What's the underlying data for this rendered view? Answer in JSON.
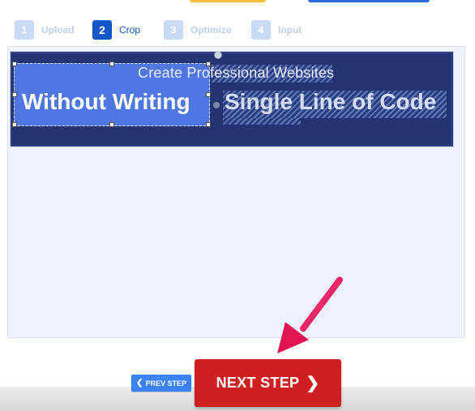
{
  "steps": [
    {
      "num": "1",
      "label": "Upload",
      "active": false
    },
    {
      "num": "2",
      "label": "Crop",
      "active": true
    },
    {
      "num": "3",
      "label": "Optimize",
      "active": false
    },
    {
      "num": "4",
      "label": "Input",
      "active": false
    }
  ],
  "banner": {
    "top_line": "Create Professional Websites",
    "main_left": "Without Writing",
    "main_right": "Single Line of Code"
  },
  "buttons": {
    "prev_label": "PREV STEP",
    "next_label": "NEXT STEP"
  },
  "colors": {
    "active_step": "#1257c6",
    "next_button": "#cf1f1f",
    "prev_button": "#3b82f6",
    "annotation_arrow": "#e8185a"
  },
  "icons": {
    "prev_chevron": "chevron-left-icon",
    "next_chevron": "chevron-right-icon"
  }
}
